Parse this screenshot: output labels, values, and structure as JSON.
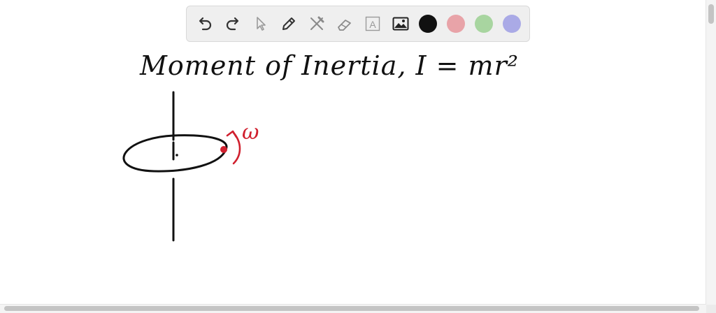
{
  "toolbar": {
    "tools": [
      {
        "name": "undo-icon"
      },
      {
        "name": "redo-icon"
      },
      {
        "name": "select-pointer-icon"
      },
      {
        "name": "pencil-icon"
      },
      {
        "name": "tools-icon"
      },
      {
        "name": "eraser-icon"
      },
      {
        "name": "text-icon",
        "glyph": "A"
      },
      {
        "name": "image-icon"
      }
    ],
    "colors": {
      "black": "#111111",
      "red": "#e8a3a8",
      "green": "#a8d5a0",
      "purple": "#aaaae6"
    }
  },
  "canvas": {
    "title_text": "Moment of Inertia,  I = mr²",
    "omega_label": "ω",
    "ink_color": "#111111",
    "accent_color": "#d0202e"
  }
}
